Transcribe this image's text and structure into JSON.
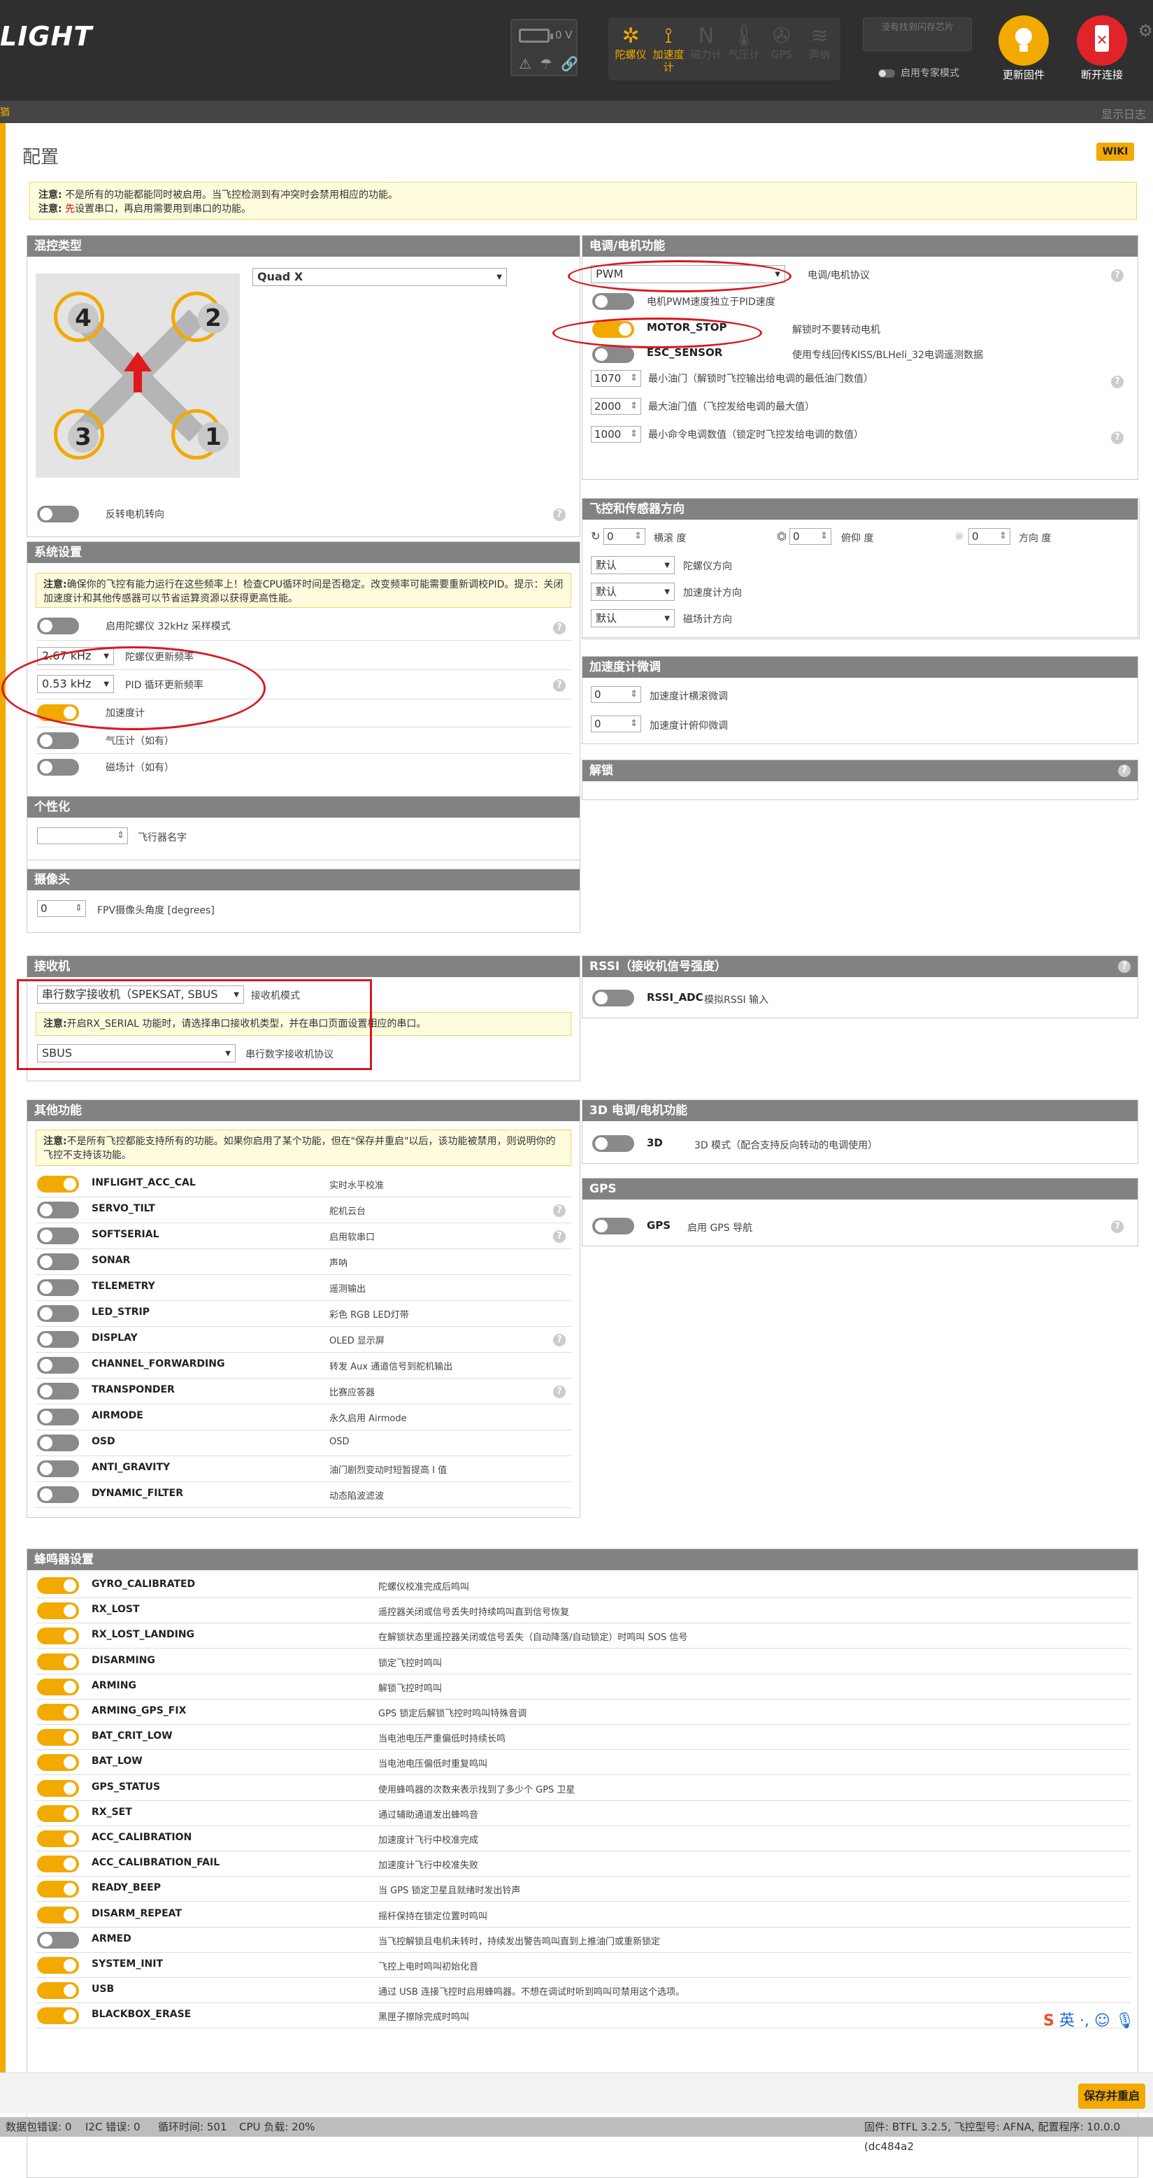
{
  "header": {
    "logo_text": "LIGHT",
    "battery_voltage": "0 V",
    "sensors": [
      {
        "name": "gyro",
        "label": "陀螺仪",
        "active": true
      },
      {
        "name": "accel",
        "label": "加速度计",
        "active": true
      },
      {
        "name": "mag",
        "label": "磁力计",
        "active": false
      },
      {
        "name": "baro",
        "label": "气压计",
        "active": false
      },
      {
        "name": "gps",
        "label": "GPS",
        "active": false
      },
      {
        "name": "sonar",
        "label": "声纳",
        "active": false
      }
    ],
    "no_dataflash": "没有找到闪存芯片",
    "expert_mode_label": "启用专家模式",
    "update_firmware": "更新固件",
    "disconnect": "断开连接",
    "subbar_left": "猶",
    "show_log": "显示日志"
  },
  "page": {
    "title": "配置",
    "wiki": "WIKI",
    "note_line1_label": "注意:",
    "note_line1": "不是所有的功能都能同时被启用。当飞控检测到有冲突时会禁用相应的功能。",
    "note_line2_label": "注意:",
    "note_line2_red": "先",
    "note_line2": "设置串口，再启用需要用到串口的功能。"
  },
  "mixer": {
    "header": "混控类型",
    "type": "Quad X",
    "motors": [
      "4",
      "2",
      "3",
      "1"
    ],
    "reverse_label": "反转电机转向"
  },
  "system": {
    "header": "系统设置",
    "note_label": "注意:",
    "note": "确保你的飞控有能力运行在这些频率上！检查CPU循环时间是否稳定。改变频率可能需要重新调校PID。提示：关闭加速度计和其他传感器可以节省运算资源以获得更高性能。",
    "gyro_32k": "启用陀螺仪 32kHz 采样模式",
    "gyro_freq": "2.67 kHz",
    "gyro_freq_label": "陀螺仪更新频率",
    "pid_freq": "0.53 kHz",
    "pid_freq_label": "PID 循环更新频率",
    "accel": "加速度计",
    "baro": "气压计（如有）",
    "mag": "磁场计（如有）"
  },
  "personal": {
    "header": "个性化",
    "craft_name_label": "飞行器名字",
    "craft_name": ""
  },
  "camera": {
    "header": "摄像头",
    "angle": "0",
    "angle_label": "FPV摄像头角度 [degrees]"
  },
  "receiver": {
    "header": "接收机",
    "mode": "串行数字接收机（SPEKSAT, SBUS",
    "mode_label": "接收机模式",
    "note_label": "注意:",
    "note": "开启RX_SERIAL 功能时，请选择串口接收机类型，并在串口页面设置相应的串口。",
    "provider": "SBUS",
    "provider_label": "串行数字接收机协议"
  },
  "other": {
    "header": "其他功能",
    "note_label": "注意:",
    "note": "不是所有飞控都能支持所有的功能。如果你启用了某个功能，但在\"保存并重启\"以后，该功能被禁用，则说明你的飞控不支持该功能。",
    "features": [
      {
        "name": "INFLIGHT_ACC_CAL",
        "desc": "实时水平校准",
        "on": true,
        "help": false
      },
      {
        "name": "SERVO_TILT",
        "desc": "舵机云台",
        "on": false,
        "help": true
      },
      {
        "name": "SOFTSERIAL",
        "desc": "启用软串口",
        "on": false,
        "help": true
      },
      {
        "name": "SONAR",
        "desc": "声呐",
        "on": false,
        "help": false
      },
      {
        "name": "TELEMETRY",
        "desc": "遥测输出",
        "on": false,
        "help": false
      },
      {
        "name": "LED_STRIP",
        "desc": "彩色 RGB LED灯带",
        "on": false,
        "help": false
      },
      {
        "name": "DISPLAY",
        "desc": "OLED 显示屏",
        "on": false,
        "help": true
      },
      {
        "name": "CHANNEL_FORWARDING",
        "desc": "转发 Aux 通道信号到舵机输出",
        "on": false,
        "help": false
      },
      {
        "name": "TRANSPONDER",
        "desc": "比赛应答器",
        "on": false,
        "help": true
      },
      {
        "name": "AIRMODE",
        "desc": "永久启用 Airmode",
        "on": false,
        "help": false
      },
      {
        "name": "OSD",
        "desc": "OSD",
        "on": false,
        "help": false
      },
      {
        "name": "ANTI_GRAVITY",
        "desc": "油门剧烈变动时短暂提高 I 值",
        "on": false,
        "help": false
      },
      {
        "name": "DYNAMIC_FILTER",
        "desc": "动态陷波滤波",
        "on": false,
        "help": false
      }
    ]
  },
  "esc": {
    "header": "电调/电机功能",
    "protocol": "PWM",
    "protocol_label": "电调/电机协议",
    "pwm_pid": "电机PWM速度独立于PID速度",
    "motor_stop": "MOTOR_STOP",
    "motor_stop_desc": "解锁时不要转动电机",
    "esc_sensor": "ESC_SENSOR",
    "esc_sensor_desc": "使用专线回传KISS/BLHeli_32电调遥测数据",
    "min_throttle": "1070",
    "min_throttle_label": "最小油门（解锁时飞控输出给电调的最低油门数值）",
    "max_throttle": "2000",
    "max_throttle_label": "最大油门值（飞控发给电调的最大值）",
    "min_command": "1000",
    "min_command_label": "最小命令电调数值（锁定时飞控发给电调的数值）"
  },
  "board": {
    "header": "飞控和传感器方向",
    "roll": "0",
    "roll_label": "横滚 度",
    "pitch": "0",
    "pitch_label": "俯仰 度",
    "yaw": "0",
    "yaw_label": "方向 度",
    "gyro_align": "默认",
    "gyro_align_label": "陀螺仪方向",
    "acc_align": "默认",
    "acc_align_label": "加速度计方向",
    "mag_align": "默认",
    "mag_align_label": "磁场计方向"
  },
  "acc_trim": {
    "header": "加速度计微调",
    "roll": "0",
    "roll_label": "加速度计横滚微调",
    "pitch": "0",
    "pitch_label": "加速度计俯仰微调"
  },
  "arming": {
    "header": "解锁"
  },
  "rssi": {
    "header": "RSSI（接收机信号强度）",
    "name": "RSSI_ADC",
    "desc": "模拟RSSI 输入"
  },
  "threed": {
    "header": "3D 电调/电机功能",
    "name": "3D",
    "desc": "3D 模式（配合支持反向转动的电调使用）"
  },
  "gps": {
    "header": "GPS",
    "name": "GPS",
    "desc": "启用 GPS 导航"
  },
  "beeper": {
    "header": "蜂鸣器设置",
    "items": [
      {
        "name": "GYRO_CALIBRATED",
        "desc": "陀螺仪校准完成后鸣叫",
        "on": true
      },
      {
        "name": "RX_LOST",
        "desc": "遥控器关闭或信号丢失时持续鸣叫直到信号恢复",
        "on": true
      },
      {
        "name": "RX_LOST_LANDING",
        "desc": "在解锁状态里遥控器关闭或信号丢失（自动降落/自动锁定）时鸣叫 SOS 信号",
        "on": true
      },
      {
        "name": "DISARMING",
        "desc": "锁定飞控时鸣叫",
        "on": true
      },
      {
        "name": "ARMING",
        "desc": "解锁飞控时鸣叫",
        "on": true
      },
      {
        "name": "ARMING_GPS_FIX",
        "desc": "GPS 锁定后解锁飞控时鸣叫特殊音调",
        "on": true
      },
      {
        "name": "BAT_CRIT_LOW",
        "desc": "当电池电压严重偏低时持续长鸣",
        "on": true
      },
      {
        "name": "BAT_LOW",
        "desc": "当电池电压偏低时重复鸣叫",
        "on": true
      },
      {
        "name": "GPS_STATUS",
        "desc": "使用蜂鸣器的次数来表示找到了多少个 GPS 卫星",
        "on": true
      },
      {
        "name": "RX_SET",
        "desc": "通过辅助通道发出蜂鸣音",
        "on": true
      },
      {
        "name": "ACC_CALIBRATION",
        "desc": "加速度计飞行中校准完成",
        "on": true
      },
      {
        "name": "ACC_CALIBRATION_FAIL",
        "desc": "加速度计飞行中校准失败",
        "on": true
      },
      {
        "name": "READY_BEEP",
        "desc": "当 GPS 锁定卫星且就绪时发出铃声",
        "on": true
      },
      {
        "name": "DISARM_REPEAT",
        "desc": "摇杆保持在锁定位置时鸣叫",
        "on": true
      },
      {
        "name": "ARMED",
        "desc": "当飞控解锁且电机未转时，持续发出警告鸣叫直到上推油门或重新锁定",
        "on": false
      },
      {
        "name": "SYSTEM_INIT",
        "desc": "飞控上电时鸣叫初始化音",
        "on": true
      },
      {
        "name": "USB",
        "desc": "通过 USB 连接飞控时启用蜂鸣器。不想在调试时听到鸣叫可禁用这个选项。",
        "on": true
      },
      {
        "name": "BLACKBOX_ERASE",
        "desc": "黑匣子擦除完成时鸣叫",
        "on": true
      }
    ]
  },
  "footer": {
    "save": "保存并重启",
    "ime": "英 ·, ☺ 🎙"
  },
  "status": {
    "packet_error": "数据包错误: 0",
    "i2c_error": "I2C 错误: 0",
    "cycle_time": "循环时间: 501",
    "cpu_load": "CPU 负载: 20%",
    "firmware": "固件: BTFL 3.2.5, 飞控型号: AFNA, 配置程序: 10.0.0 (dc484a2"
  },
  "colors": {
    "accent": "#f2a900",
    "header_bg": "#2f2f2f",
    "panel_header": "#828282",
    "annotation": "#d8191f"
  }
}
